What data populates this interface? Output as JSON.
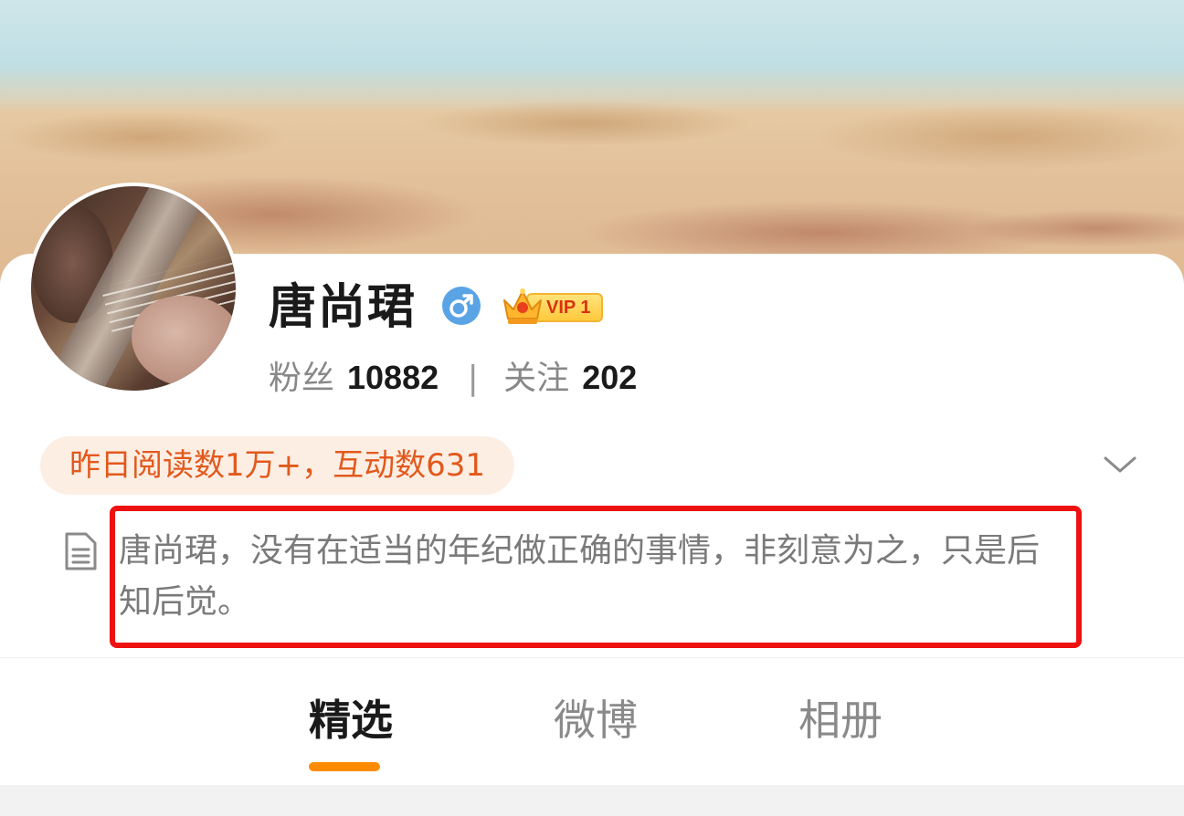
{
  "profile": {
    "name": "唐尚珺",
    "vip_label": "VIP 1",
    "colors": {
      "gender_badge": "#5aa4e6",
      "accent": "#ff8c00",
      "highlight_box": "#ee1111",
      "pill_text": "#e2591c"
    }
  },
  "stats": {
    "fans_label": "粉丝",
    "fans_count": "10882",
    "separator": "|",
    "following_label": "关注",
    "following_count": "202"
  },
  "read_pill": {
    "text": "昨日阅读数1万+，互动数631"
  },
  "bio": {
    "text": "唐尚珺，没有在适当的年纪做正确的事情，非刻意为之，只是后知后觉。"
  },
  "tabs": [
    {
      "label": "精选",
      "active": true
    },
    {
      "label": "微博",
      "active": false
    },
    {
      "label": "相册",
      "active": false
    }
  ]
}
